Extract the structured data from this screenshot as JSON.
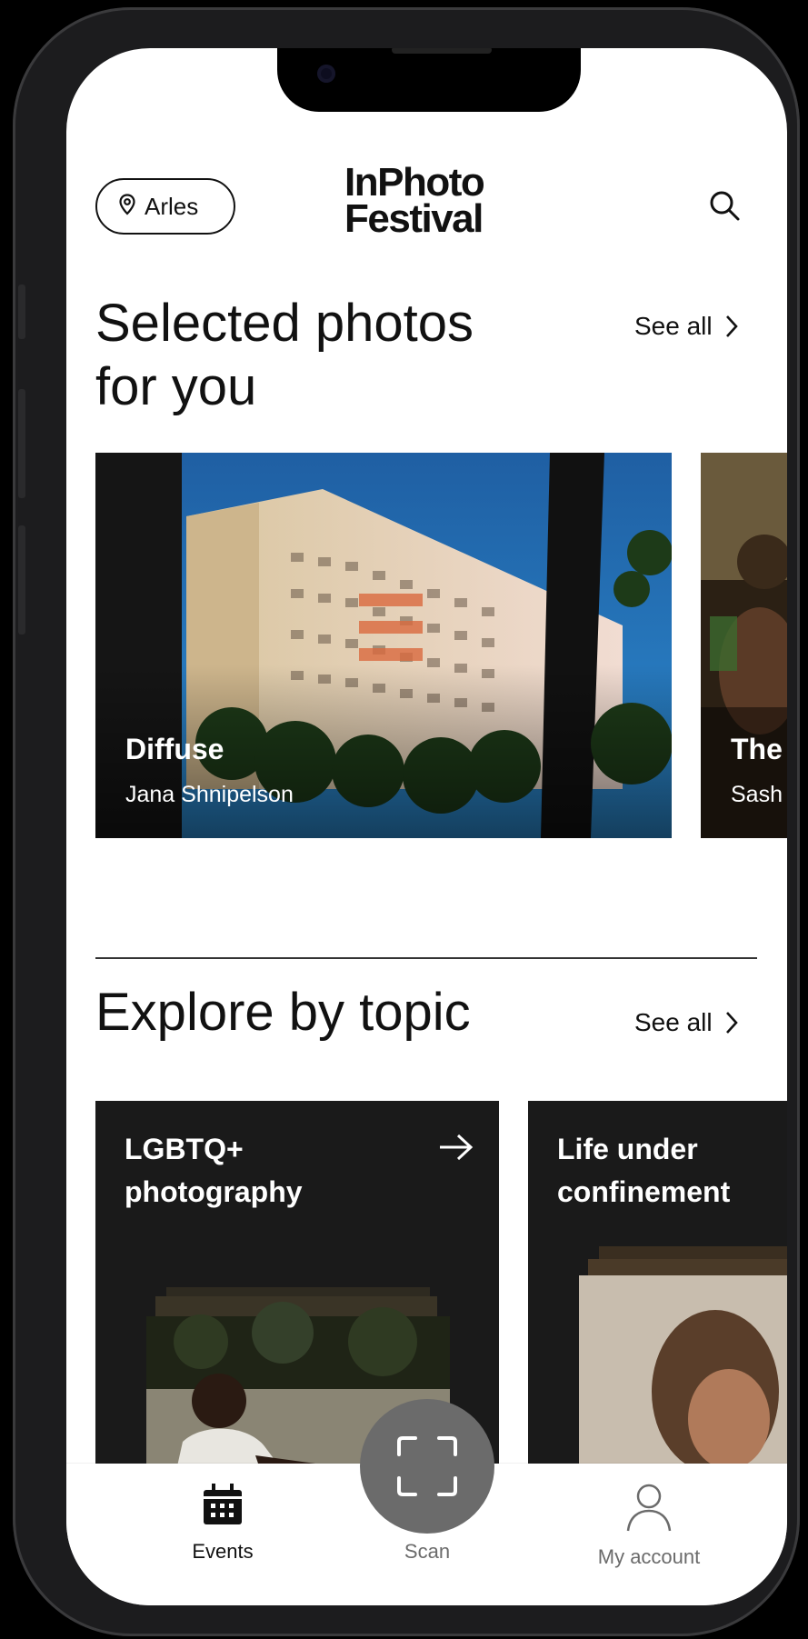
{
  "header": {
    "location": "Arles",
    "logo_line1": "InPhoto",
    "logo_line2": "Festival"
  },
  "selected": {
    "title": "Selected photos for you",
    "see_all": "See all",
    "cards": [
      {
        "title": "Diffuse",
        "author": "Jana Shnipelson"
      },
      {
        "title": "The",
        "author": "Sash"
      }
    ]
  },
  "topics": {
    "title": "Explore by topic",
    "see_all": "See all",
    "items": [
      {
        "label": "LGBTQ+ photography"
      },
      {
        "label": "Life under confinement"
      }
    ]
  },
  "tabbar": {
    "events": "Events",
    "scan": "Scan",
    "account": "My account"
  },
  "colors": {
    "text": "#111111",
    "inactive": "#6b6b6b",
    "topic_bg": "#1a1a1a",
    "scan_bg": "#6b6b6b"
  }
}
